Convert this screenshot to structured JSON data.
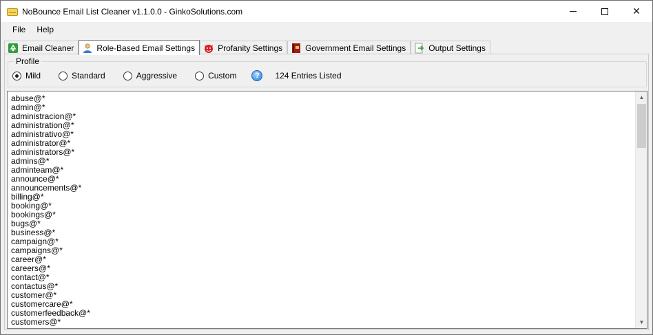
{
  "window": {
    "title": "NoBounce Email List Cleaner v1.1.0.0 - GinkoSolutions.com",
    "controls": {
      "minimize": "",
      "maximize": "",
      "close": "✕"
    }
  },
  "menu": {
    "items": [
      "File",
      "Help"
    ]
  },
  "tabs": [
    {
      "label": "Email Cleaner",
      "icon": "recycle-icon",
      "active": false
    },
    {
      "label": "Role-Based Email Settings",
      "icon": "user-icon",
      "active": true
    },
    {
      "label": "Profanity Settings",
      "icon": "devil-icon",
      "active": false
    },
    {
      "label": "Government Email Settings",
      "icon": "flag-book-icon",
      "active": false
    },
    {
      "label": "Output Settings",
      "icon": "export-arrow-icon",
      "active": false
    }
  ],
  "profile": {
    "group_label": "Profile",
    "options": [
      "Mild",
      "Standard",
      "Aggressive",
      "Custom"
    ],
    "selected": "Mild",
    "help_glyph": "?",
    "entries_text": "124 Entries Listed"
  },
  "entries": [
    "abuse@*",
    "admin@*",
    "administracion@*",
    "administration@*",
    "administrativo@*",
    "administrator@*",
    "administrators@*",
    "admins@*",
    "adminteam@*",
    "announce@*",
    "announcements@*",
    "billing@*",
    "booking@*",
    "bookings@*",
    "bugs@*",
    "business@*",
    "campaign@*",
    "campaigns@*",
    "career@*",
    "careers@*",
    "contact@*",
    "contactus@*",
    "customer@*",
    "customercare@*",
    "customerfeedback@*",
    "customers@*"
  ],
  "scrollbar": {
    "up": "▲",
    "down": "▼"
  }
}
